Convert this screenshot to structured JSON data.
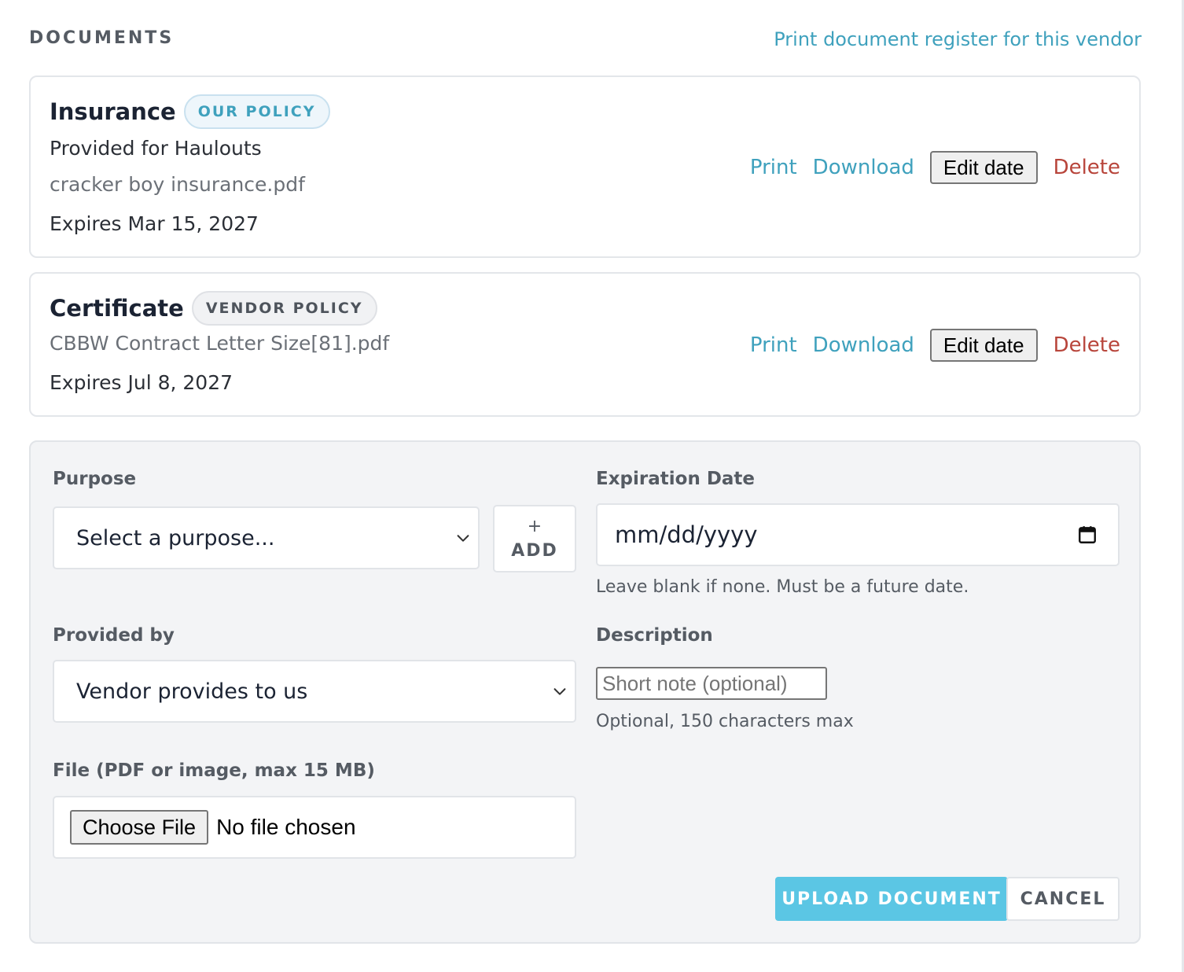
{
  "header": {
    "section_title": "DOCUMENTS",
    "register_link": "Print document register for this vendor"
  },
  "documents": [
    {
      "title": "Insurance",
      "badge": "OUR POLICY",
      "provided_for": "Provided for Haulouts",
      "filename": "cracker boy insurance.pdf",
      "expires": "Expires Mar 15, 2027",
      "actions": {
        "print": "Print",
        "download": "Download",
        "edit_date": "Edit date",
        "delete": "Delete"
      }
    },
    {
      "title": "Certificate",
      "badge": "VENDOR POLICY",
      "filename": "CBBW Contract Letter Size[81].pdf",
      "expires": "Expires Jul 8, 2027",
      "actions": {
        "print": "Print",
        "download": "Download",
        "edit_date": "Edit date",
        "delete": "Delete"
      }
    }
  ],
  "form": {
    "purpose": {
      "label": "Purpose",
      "value": "Select a purpose...",
      "add_plus": "+",
      "add_label": "ADD"
    },
    "expiration": {
      "label": "Expiration Date",
      "placeholder": "mm/dd/yyyy",
      "help": "Leave blank if none. Must be a future date."
    },
    "provided_by": {
      "label": "Provided by",
      "value": "Vendor provides to us"
    },
    "description": {
      "label": "Description",
      "placeholder": "Short note (optional)",
      "help": "Optional, 150 characters max"
    },
    "file": {
      "label": "File (PDF or image, max 15 MB)",
      "button": "Choose File",
      "status": "No file chosen"
    },
    "submit_label": "UPLOAD DOCUMENT",
    "cancel_label": "CANCEL"
  },
  "icons": {
    "chevron": "chevron-down-icon",
    "calendar": "calendar-icon"
  },
  "colors": {
    "accent": "#3fa1bd",
    "danger": "#b8453b",
    "upload_button": "#5bc6e4",
    "panel_bg": "#f3f4f6"
  }
}
